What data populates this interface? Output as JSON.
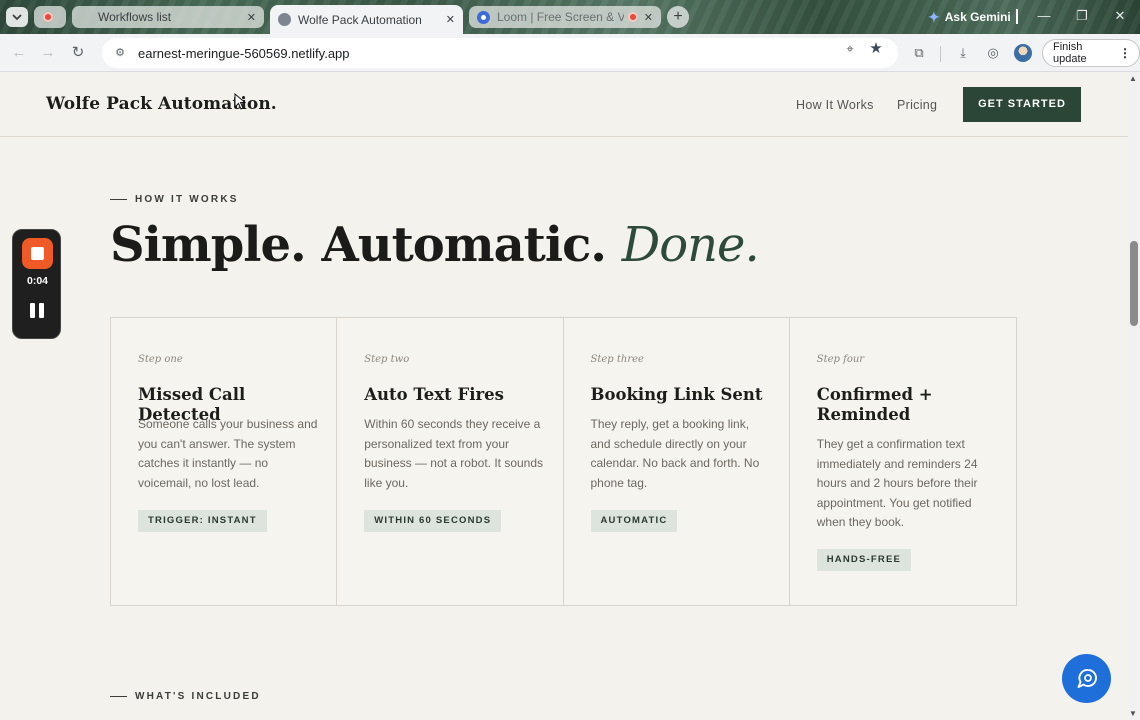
{
  "browser": {
    "tabs": [
      {
        "label": "Workflows list",
        "state": "inactive"
      },
      {
        "label": "Wolfe Pack Automation",
        "state": "active"
      },
      {
        "label": "Loom | Free Screen & Video",
        "state": "inactive"
      }
    ],
    "new_tab_symbol": "+",
    "gemini_label": "Ask Gemini",
    "url": "earnest-meringue-560569.netlify.app",
    "finish_update_label": "Finish update"
  },
  "site": {
    "brand": "Wolfe Pack Automation.",
    "nav": [
      {
        "label": "How It Works"
      },
      {
        "label": "Pricing"
      }
    ],
    "cta_label": "GET STARTED",
    "brand_color": "#2b4537"
  },
  "how_it_works": {
    "eyebrow": "HOW IT WORKS",
    "title_main": "Simple. Automatic.",
    "title_accent": "Done.",
    "steps": [
      {
        "kicker": "Step one",
        "title": "Missed Call Detected",
        "body": "Someone calls your business and you can't answer. The system catches it instantly — no voicemail, no lost lead.",
        "tag": "TRIGGER: INSTANT"
      },
      {
        "kicker": "Step two",
        "title": "Auto Text Fires",
        "body": "Within 60 seconds they receive a personalized text from your business — not a robot. It sounds like you.",
        "tag": "WITHIN 60 SECONDS"
      },
      {
        "kicker": "Step three",
        "title": "Booking Link Sent",
        "body": "They reply, get a booking link, and schedule directly on your calendar. No back and forth. No phone tag.",
        "tag": "AUTOMATIC"
      },
      {
        "kicker": "Step four",
        "title": "Confirmed + Reminded",
        "body": "They get a confirmation text immediately and reminders 24 hours and 2 hours before their appointment. You get notified when they book.",
        "tag": "HANDS-FREE"
      }
    ]
  },
  "whats_included": {
    "eyebrow": "WHAT'S INCLUDED"
  },
  "loom_recorder": {
    "elapsed": "0:04"
  },
  "icons": {
    "chat": "chat-bubble-icon",
    "record_stop": "stop-icon",
    "pause": "pause-icon"
  }
}
